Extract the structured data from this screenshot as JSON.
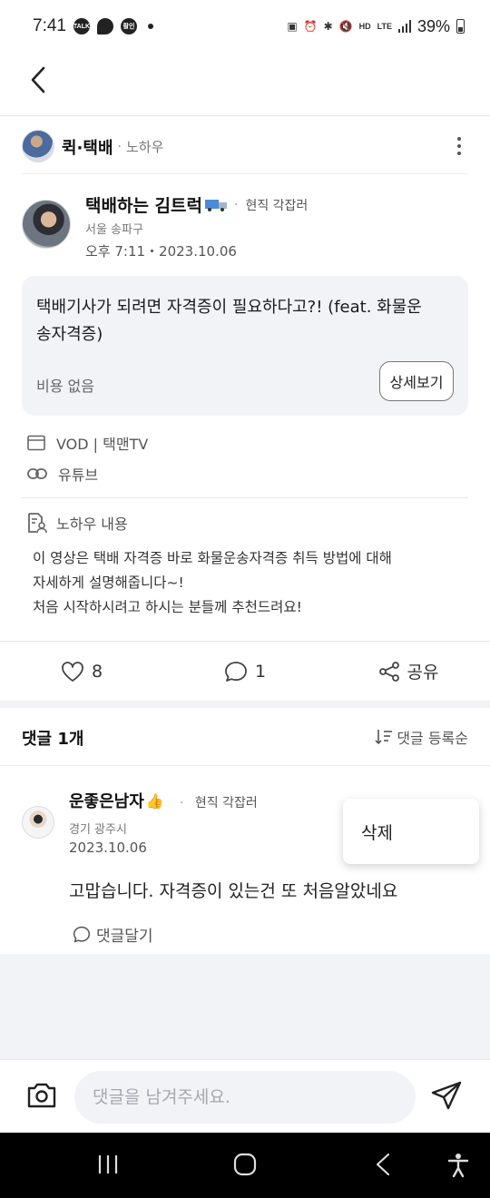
{
  "status_bar": {
    "time": "7:41",
    "notif_badges": [
      "TALK",
      "활인"
    ],
    "battery": "39%",
    "network": "LTE"
  },
  "category": {
    "name": "퀵·택배",
    "separator": "·",
    "type": "노하우"
  },
  "author": {
    "name": "택배하는 김트럭",
    "separator": "·",
    "job": "현직 각잡러",
    "location": "서울 송파구",
    "date": "오후 7:11・2023.10.06"
  },
  "card": {
    "title": "택배기사가 되려면 자격증이 필요하다고?! (feat. 화물운송자격증)",
    "cost": "비용 없음",
    "detail_label": "상세보기"
  },
  "info": {
    "vod": "VOD | 택맨TV",
    "link": "유튜브"
  },
  "knowhow": {
    "heading": "노하우 내용",
    "lines": [
      "이 영상은 택배 자격증 바로 화물운송자격증 취득 방법에 대해",
      "자세하게 설명해줍니다~!",
      "처음 시작하시려고 하시는 분들께 추천드려요!"
    ]
  },
  "actions": {
    "likes": "8",
    "comments": "1",
    "share_label": "공유"
  },
  "comments_header": {
    "title": "댓글 1개",
    "sort_label": "댓글 등록순"
  },
  "comment": {
    "name": "운좋은남자",
    "emoji": "👍",
    "separator": "·",
    "job": "현직 각잡러",
    "location": "경기 광주시",
    "date": "2023.10.06",
    "text": "고맙습니다. 자격증이 있는건 또 처음알았네요",
    "reply_label": "댓글달기"
  },
  "popup": {
    "delete_label": "삭제"
  },
  "input": {
    "placeholder": "댓글을 남겨주세요."
  },
  "colors": {
    "background": "#ffffff",
    "soft_gray": "#f2f3f6",
    "text_primary": "#111111",
    "text_secondary": "#555555",
    "nav_bar": "#000000"
  },
  "icons": {
    "back": "back-arrow-icon",
    "more": "more-vertical-icon",
    "vod": "vod-window-icon",
    "link": "link-icon",
    "knowhow": "document-person-icon",
    "like": "heart-icon",
    "comment": "comment-bubble-icon",
    "share": "share-icon",
    "sort": "sort-icon",
    "camera": "camera-icon",
    "send": "send-icon"
  }
}
